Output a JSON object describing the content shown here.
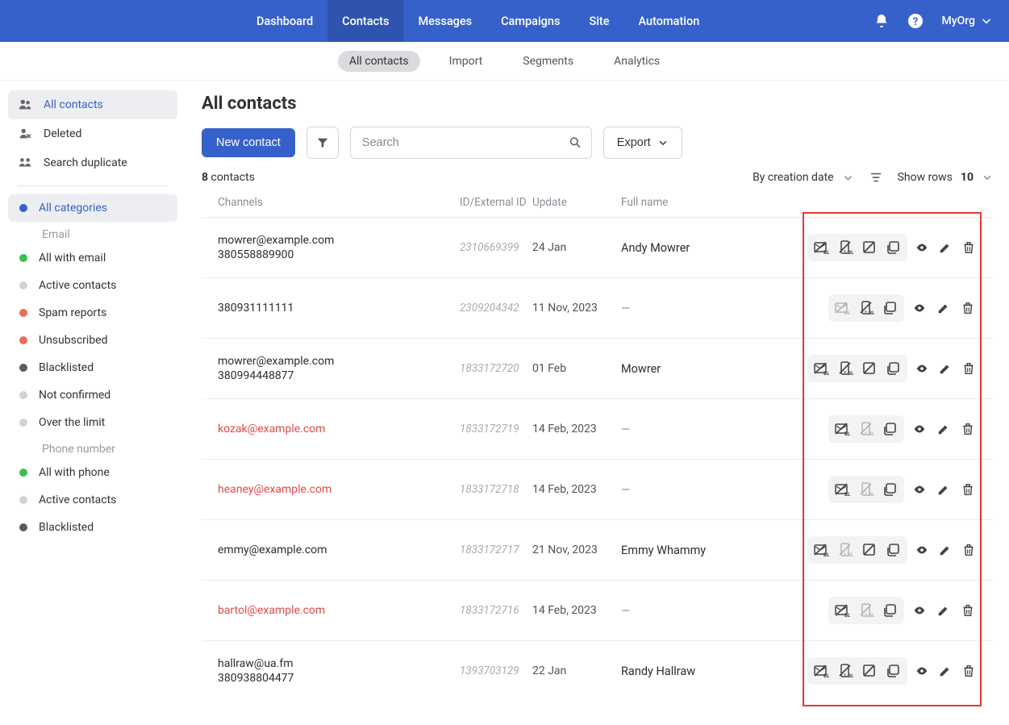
{
  "nav": {
    "items": [
      "Dashboard",
      "Contacts",
      "Messages",
      "Campaigns",
      "Site",
      "Automation"
    ],
    "active_index": 1,
    "org_label": "MyOrg"
  },
  "subtabs": {
    "items": [
      "All contacts",
      "Import",
      "Segments",
      "Analytics"
    ],
    "active_index": 0
  },
  "sidebar": {
    "group1": [
      {
        "label": "All contacts",
        "icon": "people",
        "active": true
      },
      {
        "label": "Deleted",
        "icon": "person-x"
      },
      {
        "label": "Search duplicate",
        "icon": "duplicate"
      }
    ],
    "group2_label": "All categories",
    "email_heading": "Email",
    "email_items": [
      {
        "label": "All with email",
        "dot": "#3cc04a"
      },
      {
        "label": "Active contacts",
        "dot": "#cfd2d8"
      },
      {
        "label": "Spam reports",
        "dot": "#ec6a5e"
      },
      {
        "label": "Unsubscribed",
        "dot": "#ec6a5e"
      },
      {
        "label": "Blacklisted",
        "dot": "#565a61"
      },
      {
        "label": "Not confirmed",
        "dot": "#cfd2d8"
      },
      {
        "label": "Over the limit",
        "dot": "#cfd2d8"
      }
    ],
    "phone_heading": "Phone number",
    "phone_items": [
      {
        "label": "All with phone",
        "dot": "#3cc04a"
      },
      {
        "label": "Active contacts",
        "dot": "#cfd2d8"
      },
      {
        "label": "Blacklisted",
        "dot": "#565a61"
      }
    ]
  },
  "page": {
    "title": "All contacts",
    "new_contact_label": "New contact",
    "search_placeholder": "Search",
    "export_label": "Export",
    "count_num": "8",
    "count_word": "contacts",
    "sort_label": "By creation date",
    "show_rows_label": "Show rows",
    "show_rows_value": "10"
  },
  "table": {
    "headers": {
      "channels": "Channels",
      "id": "ID/External ID",
      "update": "Update",
      "fullname": "Full name"
    },
    "rows": [
      {
        "channels": [
          "mowrer@example.com",
          "380558889900"
        ],
        "red": [
          false,
          false
        ],
        "id": "2310669399",
        "update": "24 Jan",
        "name": "Andy Mowrer",
        "actions": [
          "bl-mail",
          "bl-phone",
          "bl-strike",
          "stack"
        ],
        "dim": []
      },
      {
        "channels": [
          "380931111111"
        ],
        "red": [
          false
        ],
        "id": "2309204342",
        "update": "11 Nov, 2023",
        "name": "—",
        "actions": [
          "bl-mail",
          "bl-phone",
          "stack"
        ],
        "dim": [
          "bl-mail"
        ]
      },
      {
        "channels": [
          "mowrer@example.com",
          "380994448877"
        ],
        "red": [
          false,
          false
        ],
        "id": "1833172720",
        "update": "01 Feb",
        "name": "Mowrer",
        "actions": [
          "bl-mail",
          "bl-phone",
          "bl-strike",
          "stack"
        ],
        "dim": []
      },
      {
        "channels": [
          "kozak@example.com"
        ],
        "red": [
          true
        ],
        "id": "1833172719",
        "update": "14 Feb, 2023",
        "name": "—",
        "actions": [
          "bl-mail",
          "bl-phone",
          "stack"
        ],
        "dim": [
          "bl-phone"
        ]
      },
      {
        "channels": [
          "heaney@example.com"
        ],
        "red": [
          true
        ],
        "id": "1833172718",
        "update": "14 Feb, 2023",
        "name": "—",
        "actions": [
          "bl-mail",
          "bl-phone",
          "stack"
        ],
        "dim": [
          "bl-phone"
        ]
      },
      {
        "channels": [
          "emmy@example.com"
        ],
        "red": [
          false
        ],
        "id": "1833172717",
        "update": "21 Nov, 2023",
        "name": "Emmy Whammy",
        "actions": [
          "bl-mail",
          "bl-phone",
          "bl-strike",
          "stack"
        ],
        "dim": [
          "bl-phone"
        ]
      },
      {
        "channels": [
          "bartol@example.com"
        ],
        "red": [
          true
        ],
        "id": "1833172716",
        "update": "14 Feb, 2023",
        "name": "—",
        "actions": [
          "bl-mail",
          "bl-phone",
          "stack"
        ],
        "dim": [
          "bl-phone"
        ]
      },
      {
        "channels": [
          "hallraw@ua.fm",
          "380938804477"
        ],
        "red": [
          false,
          false
        ],
        "id": "1393703129",
        "update": "22 Jan",
        "name": "Randy Hallraw",
        "actions": [
          "bl-mail",
          "bl-phone",
          "bl-strike",
          "stack"
        ],
        "dim": []
      }
    ]
  }
}
